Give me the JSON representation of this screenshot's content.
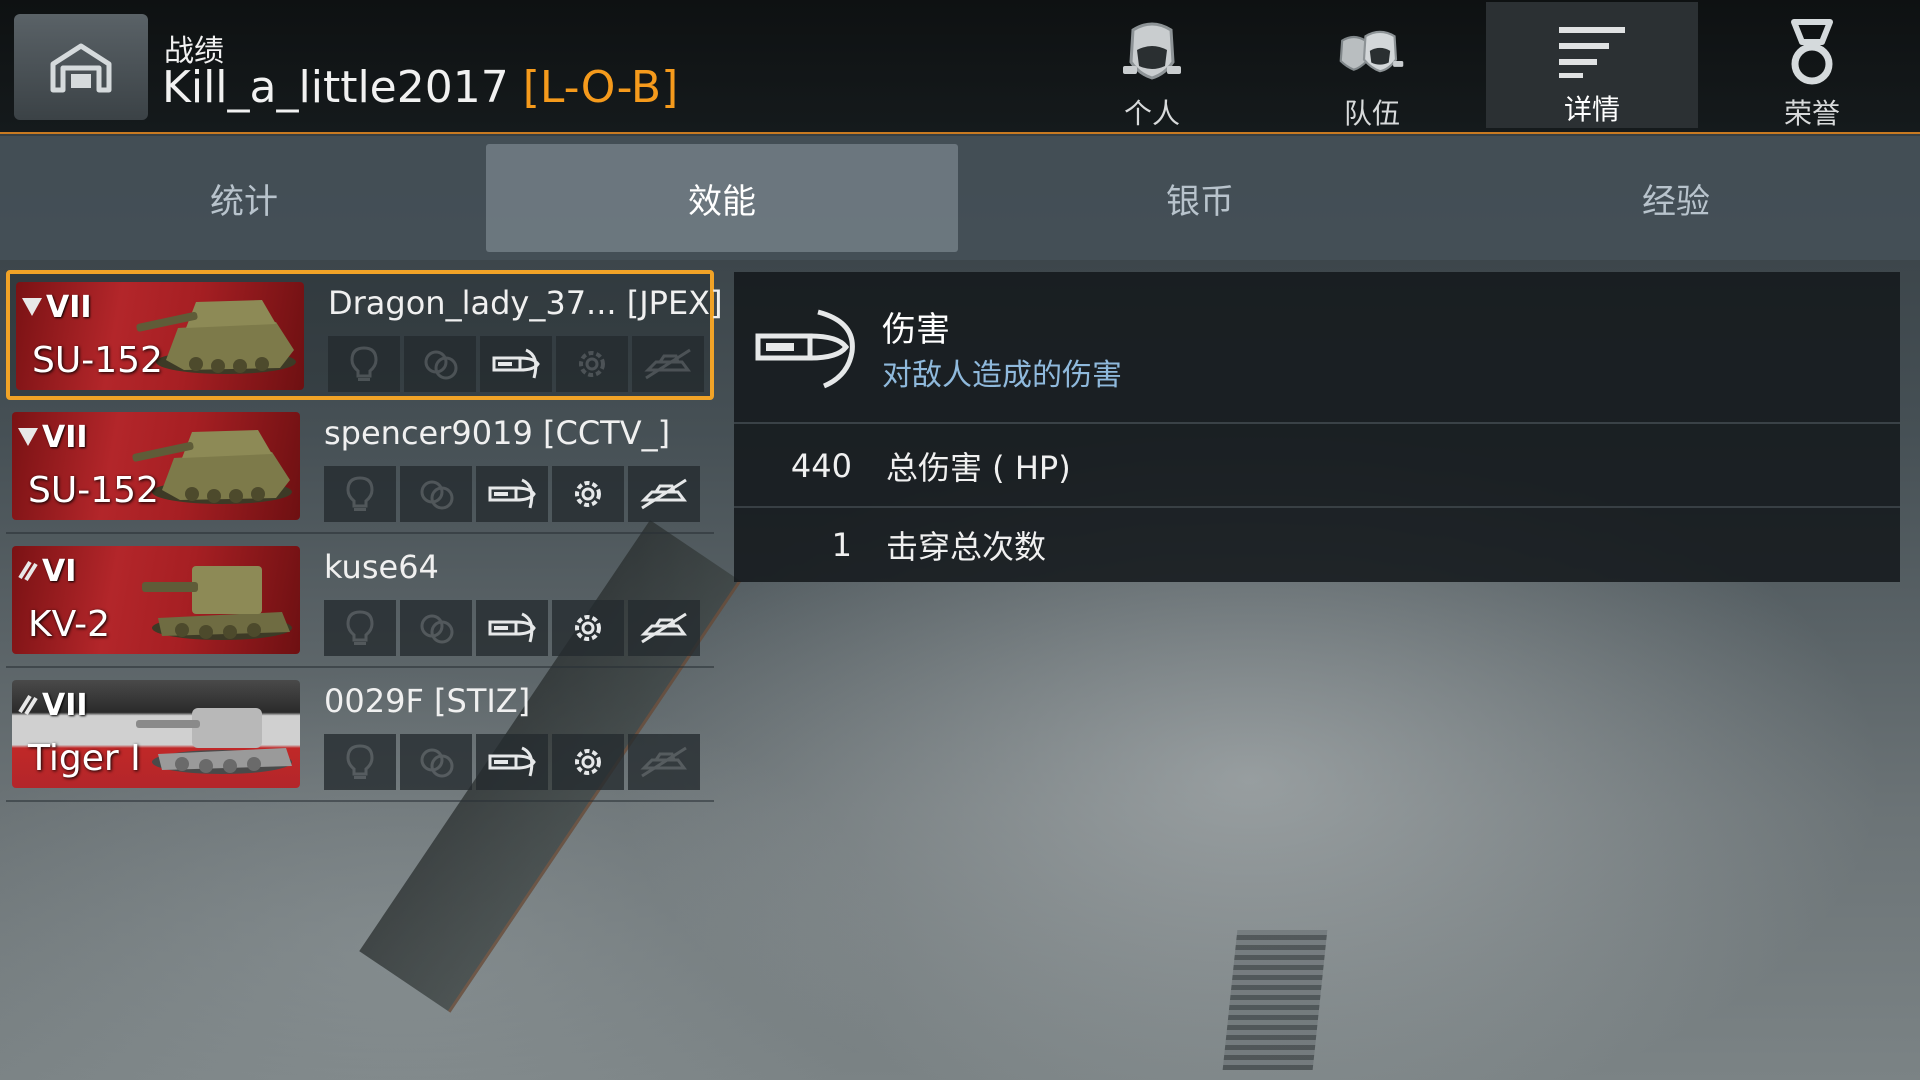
{
  "header": {
    "section_label": "战绩",
    "player_name": "Kill_a_little2017",
    "player_clan": "[L-O-B]",
    "nav_tabs": [
      {
        "label": "个人",
        "icon": "helmet-icon"
      },
      {
        "label": "队伍",
        "icon": "team-helmets-icon"
      },
      {
        "label": "详情",
        "icon": "details-lines-icon",
        "active": true
      },
      {
        "label": "荣誉",
        "icon": "medal-icon"
      }
    ]
  },
  "subtabs": [
    {
      "label": "统计"
    },
    {
      "label": "效能",
      "active": true
    },
    {
      "label": "银币"
    },
    {
      "label": "经验"
    }
  ],
  "vehicles": [
    {
      "tier": "VII",
      "name": "SU-152",
      "nation": "ussr",
      "class_icon": "td-class-icon",
      "player": "Dragon_lady_37...  [JPEX]",
      "selected": true,
      "badges": {
        "spotting": false,
        "assist": false,
        "damage": true,
        "crits": false,
        "kill": false
      }
    },
    {
      "tier": "VII",
      "name": "SU-152",
      "nation": "ussr",
      "class_icon": "td-class-icon",
      "player": "spencer9019 [CCTV_]",
      "selected": false,
      "badges": {
        "spotting": false,
        "assist": false,
        "damage": true,
        "crits": true,
        "kill": true
      }
    },
    {
      "tier": "VI",
      "name": "KV-2",
      "nation": "ussr",
      "class_icon": "heavy-class-icon",
      "player": "kuse64",
      "selected": false,
      "badges": {
        "spotting": false,
        "assist": false,
        "damage": true,
        "crits": true,
        "kill": true
      }
    },
    {
      "tier": "VII",
      "name": "Tiger I",
      "nation": "germany",
      "class_icon": "heavy-class-icon",
      "player": "0029F [STIZ]",
      "selected": false,
      "badges": {
        "spotting": false,
        "assist": false,
        "damage": true,
        "crits": true,
        "kill": false
      }
    }
  ],
  "detail": {
    "title": "伤害",
    "subtitle": "对敌人造成的伤害",
    "icon": "damage-shell-icon",
    "rows": [
      {
        "value": "440",
        "label": "总伤害 ( HP)"
      },
      {
        "value": "1",
        "label": "击穿总次数"
      }
    ]
  },
  "colors": {
    "accent": "#f1a327",
    "clan": "#f59a1c",
    "subtitle": "#8fb9dc"
  }
}
